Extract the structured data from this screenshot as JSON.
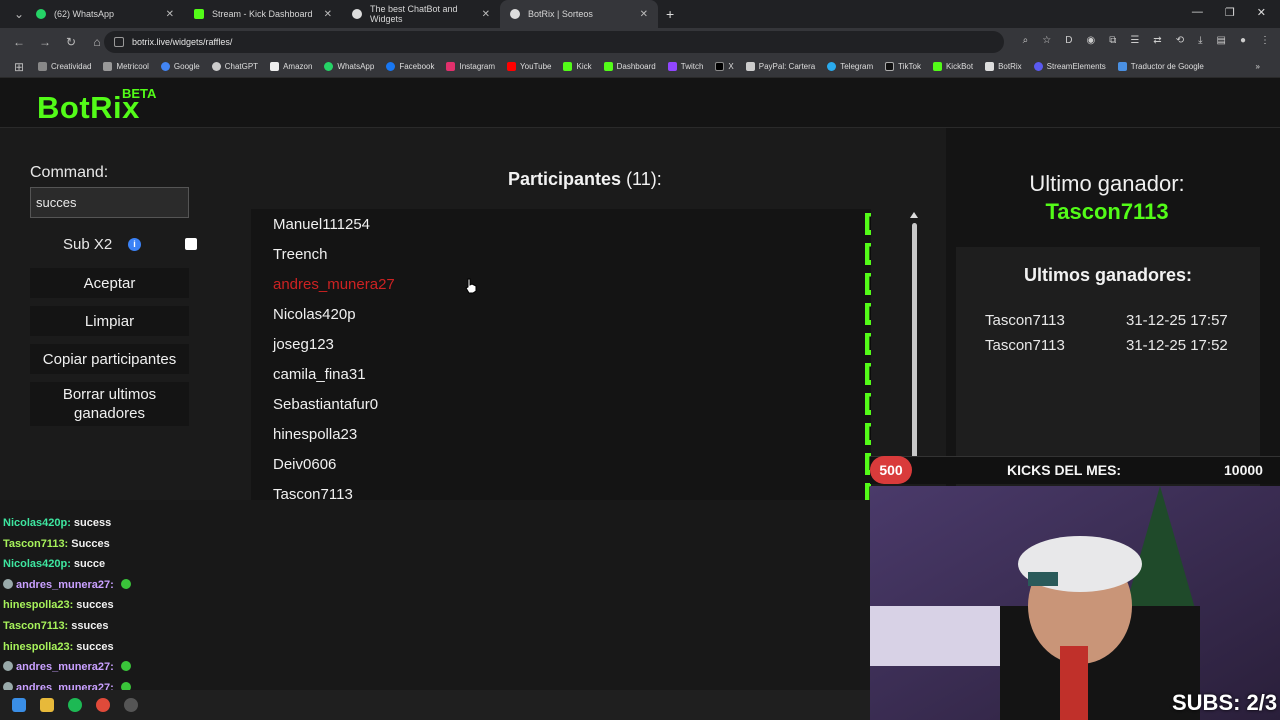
{
  "browser": {
    "tabs": [
      {
        "title": "(62) WhatsApp",
        "color": "#25d366"
      },
      {
        "title": "Stream - Kick Dashboard",
        "color": "#53fc18"
      },
      {
        "title": "The best ChatBot and Widgets",
        "color": "#dddddd"
      },
      {
        "title": "BotRix | Sorteos",
        "color": "#dddddd"
      }
    ],
    "url": "botrix.live/widgets/raffles/",
    "bookmarks": [
      "Creatividad",
      "Metricool",
      "Google",
      "ChatGPT",
      "Amazon",
      "WhatsApp",
      "Facebook",
      "Instagram",
      "YouTube",
      "Kick",
      "Dashboard",
      "Twitch",
      "X",
      "PayPal: Cartera",
      "Telegram",
      "TikTok",
      "KickBot",
      "BotRix",
      "StreamElements",
      "Traductor de Google"
    ]
  },
  "app": {
    "logo": "BotRix",
    "badge": "BETA"
  },
  "left": {
    "command_label": "Command:",
    "command_value": "succes",
    "sub_label": "Sub X2",
    "info_icon": "i",
    "accept": "Aceptar",
    "clear": "Limpiar",
    "copy": "Copiar participantes",
    "delete_winners": "Borrar ultimos ganadores"
  },
  "participants": {
    "title": "Participantes",
    "count": "(11):",
    "names": [
      "Manuel111254",
      "Treench",
      "andres_munera27",
      "Nicolas420p",
      "joseg123",
      "camila_fina31",
      "Sebastiantafur0",
      "hinespolla23",
      "Deiv0606",
      "Tascon7113"
    ],
    "highlight_color": "#cc2222",
    "badge_letter": "K"
  },
  "winner": {
    "title": "Ultimo ganador:",
    "name": "Tascon7113",
    "recent_title": "Ultimos ganadores:",
    "recent": [
      {
        "name": "Tascon7113",
        "date": "31-12-25 17:57"
      },
      {
        "name": "Tascon7113",
        "date": "31-12-25 17:52"
      }
    ]
  },
  "chat": [
    {
      "user": "Nicolas420p:",
      "text": "sucess"
    },
    {
      "user": "Tascon7113:",
      "text": "Succes"
    },
    {
      "user": "Nicolas420p:",
      "text": "succe"
    },
    {
      "user": "andres_munera27:",
      "text": ""
    },
    {
      "user": "hinespolla23:",
      "text": "succes"
    },
    {
      "user": "Tascon7113:",
      "text": "ssuces"
    },
    {
      "user": "hinespolla23:",
      "text": "succes"
    },
    {
      "user": "andres_munera27:",
      "text": ""
    },
    {
      "user": "andres_munera27:",
      "text": ""
    }
  ],
  "overlay": {
    "kicks_badge": "500",
    "kicks_label": "KICKS DEL MES:",
    "kicks_value": "10000",
    "subs": "SUBS: 2/3"
  }
}
